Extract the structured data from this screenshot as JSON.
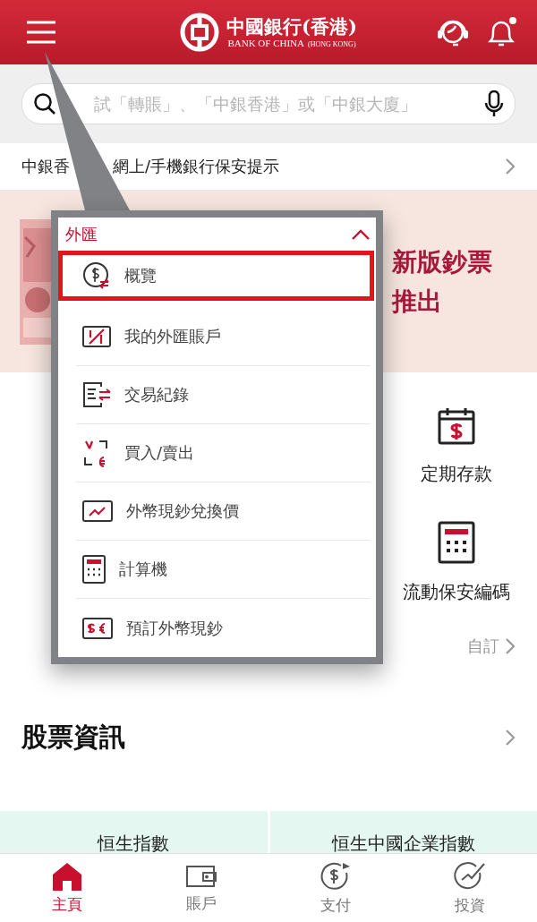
{
  "header": {
    "logo_cn": "中國銀行(香港)",
    "logo_en": "BANK OF CHINA",
    "logo_en_sub": "(HONG KONG)",
    "notification_dot": true
  },
  "search": {
    "placeholder": "試「轉賬」、「中銀香港」或「中銀大廈」"
  },
  "notice": {
    "parts": [
      "中銀香",
      "網上/手機銀行保安提示"
    ]
  },
  "banner": {
    "lines": [
      "新版鈔票",
      "推出"
    ]
  },
  "quick_links": [
    {
      "label": "定期存款"
    },
    {
      "label": "流動保安編碼"
    }
  ],
  "customize": "自訂",
  "stocks": {
    "title": "股票資訊",
    "cards": [
      "恒生指數",
      "恒生中國企業指數"
    ]
  },
  "popup": {
    "title": "外匯",
    "expanded": true,
    "items": [
      {
        "label": "概覽",
        "selected": true
      },
      {
        "label": "我的外匯賬戶",
        "selected": false
      },
      {
        "label": "交易紀錄",
        "selected": false
      },
      {
        "label": "買入/賣出",
        "selected": false
      },
      {
        "label": "外幣現鈔兌換價",
        "selected": false
      },
      {
        "label": "計算機",
        "selected": false
      },
      {
        "label": "預訂外幣現鈔",
        "selected": false
      }
    ]
  },
  "tabs": [
    {
      "label": "主頁",
      "selected": true
    },
    {
      "label": "賬戶",
      "selected": false
    },
    {
      "label": "支付",
      "selected": false
    },
    {
      "label": "投資",
      "selected": false
    }
  ]
}
